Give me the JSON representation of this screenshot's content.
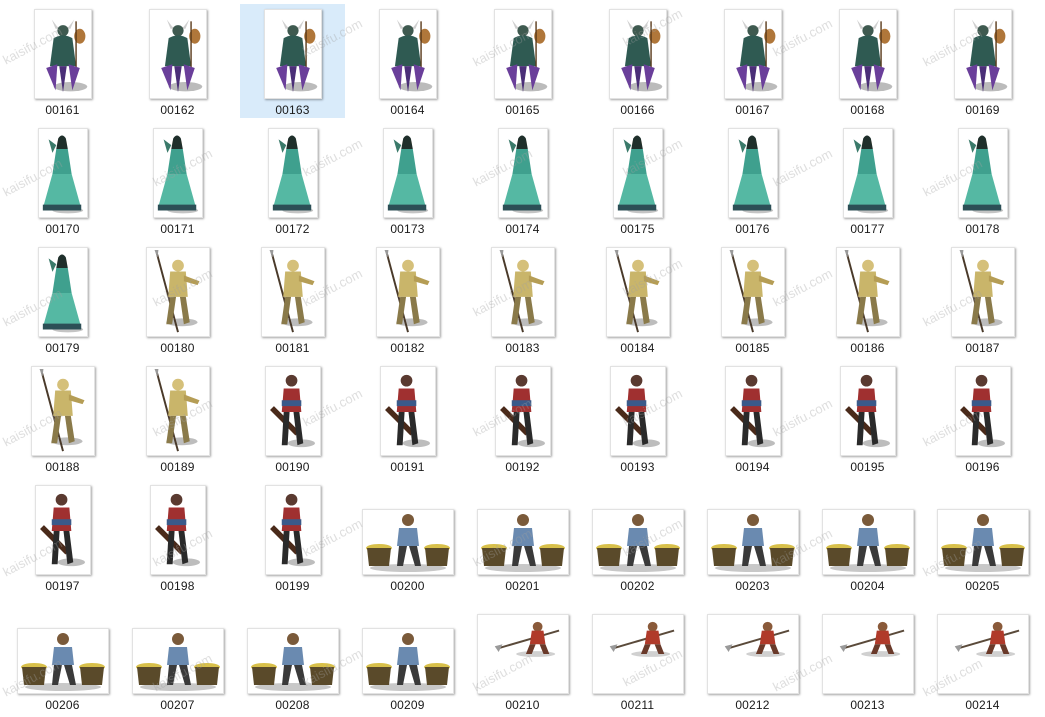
{
  "selected_file": "00163",
  "files": [
    {
      "name": "00161",
      "icon": "bull-demon-king-sprite"
    },
    {
      "name": "00162",
      "icon": "bull-demon-king-sprite"
    },
    {
      "name": "00163",
      "icon": "bull-demon-king-sprite"
    },
    {
      "name": "00164",
      "icon": "bull-demon-king-sprite"
    },
    {
      "name": "00165",
      "icon": "bull-demon-king-sprite"
    },
    {
      "name": "00166",
      "icon": "bull-demon-king-sprite"
    },
    {
      "name": "00167",
      "icon": "bull-demon-king-sprite"
    },
    {
      "name": "00168",
      "icon": "bull-demon-king-sprite"
    },
    {
      "name": "00169",
      "icon": "bull-demon-king-sprite"
    },
    {
      "name": "00170",
      "icon": "teal-robed-lady-sprite"
    },
    {
      "name": "00171",
      "icon": "teal-robed-lady-sprite"
    },
    {
      "name": "00172",
      "icon": "teal-robed-lady-sprite"
    },
    {
      "name": "00173",
      "icon": "teal-robed-lady-sprite"
    },
    {
      "name": "00174",
      "icon": "teal-robed-lady-sprite"
    },
    {
      "name": "00175",
      "icon": "teal-robed-lady-sprite"
    },
    {
      "name": "00176",
      "icon": "teal-robed-lady-sprite"
    },
    {
      "name": "00177",
      "icon": "teal-robed-lady-sprite"
    },
    {
      "name": "00178",
      "icon": "teal-robed-lady-sprite"
    },
    {
      "name": "00179",
      "icon": "teal-robed-lady-sprite"
    },
    {
      "name": "00180",
      "icon": "spear-warrior-sprite"
    },
    {
      "name": "00181",
      "icon": "spear-warrior-sprite"
    },
    {
      "name": "00182",
      "icon": "spear-warrior-sprite"
    },
    {
      "name": "00183",
      "icon": "spear-warrior-sprite"
    },
    {
      "name": "00184",
      "icon": "spear-warrior-sprite"
    },
    {
      "name": "00185",
      "icon": "spear-warrior-sprite"
    },
    {
      "name": "00186",
      "icon": "spear-warrior-sprite"
    },
    {
      "name": "00187",
      "icon": "spear-warrior-sprite"
    },
    {
      "name": "00188",
      "icon": "spear-warrior-sprite"
    },
    {
      "name": "00189",
      "icon": "spear-warrior-sprite"
    },
    {
      "name": "00190",
      "icon": "crossbow-soldier-sprite"
    },
    {
      "name": "00191",
      "icon": "crossbow-soldier-sprite"
    },
    {
      "name": "00192",
      "icon": "crossbow-soldier-sprite"
    },
    {
      "name": "00193",
      "icon": "crossbow-soldier-sprite"
    },
    {
      "name": "00194",
      "icon": "crossbow-soldier-sprite"
    },
    {
      "name": "00195",
      "icon": "crossbow-soldier-sprite"
    },
    {
      "name": "00196",
      "icon": "crossbow-soldier-sprite"
    },
    {
      "name": "00197",
      "icon": "crossbow-soldier-sprite"
    },
    {
      "name": "00198",
      "icon": "crossbow-soldier-sprite"
    },
    {
      "name": "00199",
      "icon": "crossbow-soldier-sprite"
    },
    {
      "name": "00200",
      "icon": "basket-porter-sprite"
    },
    {
      "name": "00201",
      "icon": "basket-porter-sprite"
    },
    {
      "name": "00202",
      "icon": "basket-porter-sprite"
    },
    {
      "name": "00203",
      "icon": "basket-porter-sprite"
    },
    {
      "name": "00204",
      "icon": "basket-porter-sprite"
    },
    {
      "name": "00205",
      "icon": "basket-porter-sprite"
    },
    {
      "name": "00206",
      "icon": "basket-porter-sprite"
    },
    {
      "name": "00207",
      "icon": "basket-porter-sprite"
    },
    {
      "name": "00208",
      "icon": "basket-porter-sprite"
    },
    {
      "name": "00209",
      "icon": "basket-porter-sprite"
    },
    {
      "name": "00210",
      "icon": "halberd-knight-sprite"
    },
    {
      "name": "00211",
      "icon": "halberd-knight-sprite"
    },
    {
      "name": "00212",
      "icon": "halberd-knight-sprite"
    },
    {
      "name": "00213",
      "icon": "halberd-knight-sprite"
    },
    {
      "name": "00214",
      "icon": "halberd-knight-sprite"
    }
  ],
  "watermark": "kaisifu.com",
  "colors": {
    "selection": "#d9ebfa",
    "label": "#1a1a1a"
  }
}
